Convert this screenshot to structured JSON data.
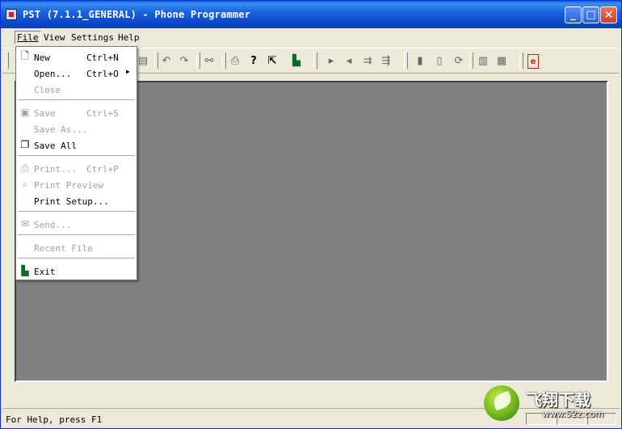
{
  "window": {
    "title": "PST (7.1.1_GENERAL) - Phone Programmer",
    "minimize_glyph": "_",
    "maximize_glyph": "□",
    "close_glyph": "✕"
  },
  "menubar": {
    "file": "File",
    "view": "View",
    "settings": "Settings",
    "help": "Help"
  },
  "file_menu": {
    "items": [
      {
        "label": "New",
        "shortcut": "Ctrl+N",
        "icon": "new-file-icon",
        "enabled": true
      },
      {
        "label": "Open...",
        "shortcut": "Ctrl+O",
        "submenu": true,
        "enabled": true
      },
      {
        "label": "Close",
        "enabled": false
      },
      {
        "label": "Save",
        "shortcut": "Ctrl+S",
        "icon": "save-icon",
        "enabled": false
      },
      {
        "label": "Save As...",
        "enabled": false
      },
      {
        "label": "Save All",
        "icon": "save-all-icon",
        "enabled": true
      },
      {
        "label": "Print...",
        "shortcut": "Ctrl+P",
        "icon": "print-icon",
        "enabled": false
      },
      {
        "label": "Print Preview",
        "icon": "print-preview-icon",
        "enabled": false
      },
      {
        "label": "Print Setup...",
        "enabled": true
      },
      {
        "label": "Send...",
        "icon": "send-icon",
        "enabled": false
      },
      {
        "label": "Recent File",
        "enabled": false
      },
      {
        "label": "Exit",
        "icon": "exit-icon",
        "enabled": true
      }
    ]
  },
  "statusbar": {
    "text": "For Help, press F1"
  },
  "watermark": {
    "title": "飞翔下载",
    "url": "www.52z.com"
  },
  "colors": {
    "titlebar": "#0a46c8",
    "client_bg": "#808080",
    "chrome": "#ece9d8"
  }
}
